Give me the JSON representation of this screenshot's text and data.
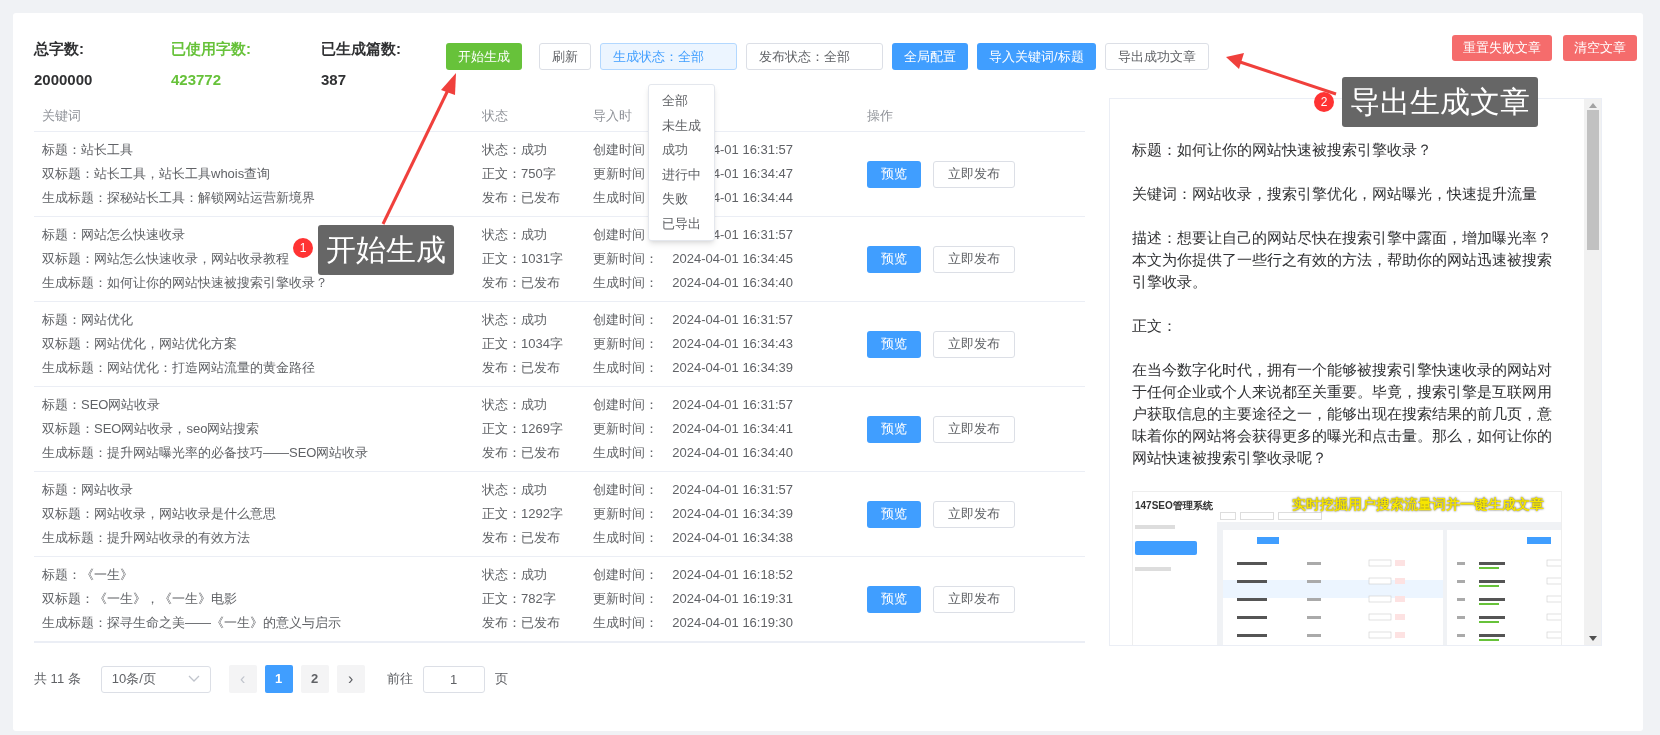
{
  "stats": [
    {
      "label": "总字数:",
      "value": "2000000",
      "accent": false
    },
    {
      "label": "已使用字数:",
      "value": "423772",
      "accent": true
    },
    {
      "label": "已生成篇数:",
      "value": "387",
      "accent": false
    }
  ],
  "toolbar": [
    {
      "kind": "success",
      "label": "开始生成"
    },
    {
      "kind": "plain",
      "label": "刷新"
    },
    {
      "kind": "select",
      "label": "生成状态：全部",
      "selected": true
    },
    {
      "kind": "select",
      "label": "发布状态：全部",
      "selected": false
    },
    {
      "kind": "primary",
      "label": "全局配置"
    },
    {
      "kind": "primary",
      "label": "导入关键词/标题"
    },
    {
      "kind": "plain",
      "label": "导出成功文章"
    }
  ],
  "danger_buttons": [
    "重置失败文章",
    "清空文章"
  ],
  "status_menu": [
    "全部",
    "未生成",
    "成功",
    "进行中",
    "失败",
    "已导出"
  ],
  "table": {
    "columns": [
      "关键词",
      "状态",
      "导入时",
      "操作"
    ],
    "rows": [
      {
        "keyword": [
          "标题：站长工具",
          "双标题：站长工具，站长工具whois查询",
          "生成标题：探秘站长工具：解锁网站运营新境界"
        ],
        "status": [
          "状态：成功",
          "正文：750字",
          "发布：已发布"
        ],
        "times": [
          {
            "label": "创建时间",
            "value": "4-01 16:31:57"
          },
          {
            "label": "更新时间",
            "value": "4-01 16:34:47"
          },
          {
            "label": "生成时间",
            "value": "4-01 16:34:44"
          }
        ],
        "actions": [
          "预览",
          "立即发布"
        ]
      },
      {
        "keyword": [
          "标题：网站怎么快速收录",
          "双标题：网站怎么快速收录，网站收录教程",
          "生成标题：如何让你的网站快速被搜索引擎收录？"
        ],
        "status": [
          "状态：成功",
          "正文：1031字",
          "发布：已发布"
        ],
        "times": [
          {
            "label": "创建时间",
            "value": "4-01 16:31:57"
          },
          {
            "label": "更新时间：",
            "value": "2024-04-01 16:34:45"
          },
          {
            "label": "生成时间：",
            "value": "2024-04-01 16:34:40"
          }
        ],
        "actions": [
          "预览",
          "立即发布"
        ]
      },
      {
        "keyword": [
          "标题：网站优化",
          "双标题：网站优化，网站优化方案",
          "生成标题：网站优化：打造网站流量的黄金路径"
        ],
        "status": [
          "状态：成功",
          "正文：1034字",
          "发布：已发布"
        ],
        "times": [
          {
            "label": "创建时间：",
            "value": "2024-04-01 16:31:57"
          },
          {
            "label": "更新时间：",
            "value": "2024-04-01 16:34:43"
          },
          {
            "label": "生成时间：",
            "value": "2024-04-01 16:34:39"
          }
        ],
        "actions": [
          "预览",
          "立即发布"
        ]
      },
      {
        "keyword": [
          "标题：SEO网站收录",
          "双标题：SEO网站收录，seo网站搜索",
          "生成标题：提升网站曝光率的必备技巧——SEO网站收录"
        ],
        "status": [
          "状态：成功",
          "正文：1269字",
          "发布：已发布"
        ],
        "times": [
          {
            "label": "创建时间：",
            "value": "2024-04-01 16:31:57"
          },
          {
            "label": "更新时间：",
            "value": "2024-04-01 16:34:41"
          },
          {
            "label": "生成时间：",
            "value": "2024-04-01 16:34:40"
          }
        ],
        "actions": [
          "预览",
          "立即发布"
        ]
      },
      {
        "keyword": [
          "标题：网站收录",
          "双标题：网站收录，网站收录是什么意思",
          "生成标题：提升网站收录的有效方法"
        ],
        "status": [
          "状态：成功",
          "正文：1292字",
          "发布：已发布"
        ],
        "times": [
          {
            "label": "创建时间：",
            "value": "2024-04-01 16:31:57"
          },
          {
            "label": "更新时间：",
            "value": "2024-04-01 16:34:39"
          },
          {
            "label": "生成时间：",
            "value": "2024-04-01 16:34:38"
          }
        ],
        "actions": [
          "预览",
          "立即发布"
        ]
      },
      {
        "keyword": [
          "标题：《一生》",
          "双标题：《一生》，《一生》电影",
          "生成标题：探寻生命之美——《一生》的意义与启示"
        ],
        "status": [
          "状态：成功",
          "正文：782字",
          "发布：已发布"
        ],
        "times": [
          {
            "label": "创建时间：",
            "value": "2024-04-01 16:18:52"
          },
          {
            "label": "更新时间：",
            "value": "2024-04-01 16:19:31"
          },
          {
            "label": "生成时间：",
            "value": "2024-04-01 16:19:30"
          }
        ],
        "actions": [
          "预览",
          "立即发布"
        ]
      }
    ]
  },
  "pagination": {
    "total": "共 11 条",
    "page_size": "10条/页",
    "prev": "‹",
    "next": "›",
    "pages": [
      {
        "label": "1",
        "selected": true
      },
      {
        "label": "2",
        "selected": false
      }
    ],
    "goto_label": "前往",
    "goto_value": "1",
    "page_suffix": "页"
  },
  "preview": {
    "paragraphs": [
      "标题：如何让你的网站快速被搜索引擎收录？",
      "关键词：网站收录，搜索引擎优化，网站曝光，快速提升流量",
      "描述：想要让自己的网站尽快在搜索引擎中露面，增加曝光率？本文为你提供了一些行之有效的方法，帮助你的网站迅速被搜索引擎收录。",
      "正文：",
      "在当今数字化时代，拥有一个能够被搜索引擎快速收录的网站对于任何企业或个人来说都至关重要。毕竟，搜索引擎是互联网用户获取信息的主要途径之一，能够出现在搜索结果的前几页，意味着你的网站将会获得更多的曝光和点击量。那么，如何让你的网站快速被搜索引擎收录呢？"
    ],
    "screenshot": {
      "app_title": "147SEO管理系统",
      "banner": "实时挖掘用户搜索流量词并一键生成文章"
    }
  },
  "annotations": [
    {
      "number": "1",
      "label": "开始生成"
    },
    {
      "number": "2",
      "label": "导出生成文章"
    }
  ]
}
